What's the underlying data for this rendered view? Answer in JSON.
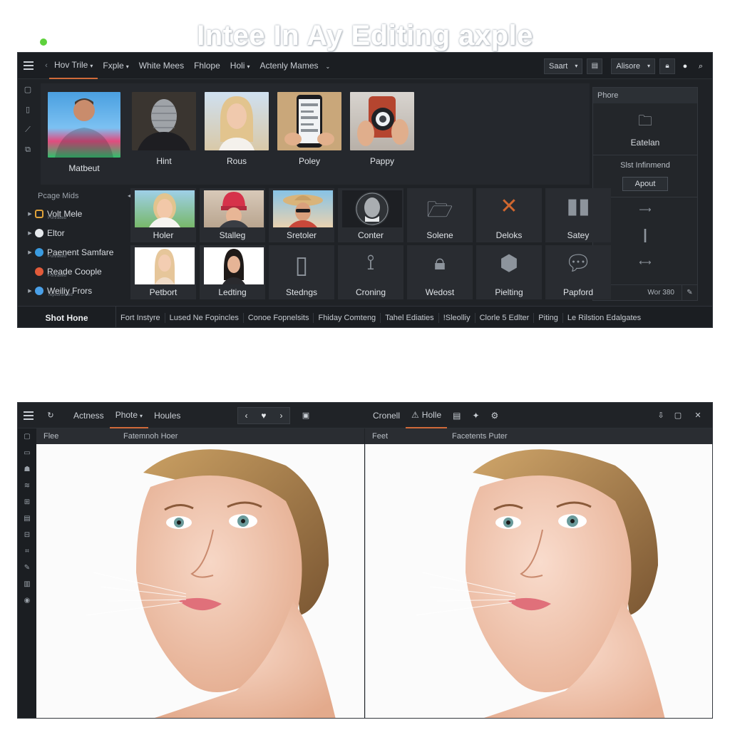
{
  "headline": "Intee In Ay Editing axple",
  "colors": {
    "accent": "#d06a3a",
    "status_dot": "#5ed13c",
    "bg_dark": "#1f2226"
  },
  "top_window": {
    "menu": [
      {
        "label": "Hov Trile",
        "active": true,
        "chevron": true
      },
      {
        "label": "Fxple",
        "chevron": true
      },
      {
        "label": "White Mees"
      },
      {
        "label": "Fhlope"
      },
      {
        "label": "Holi",
        "chevron": true
      },
      {
        "label": "Actenly Mames",
        "chevron": true
      }
    ],
    "right_dropdown_1": "Saart",
    "right_dropdown_2": "Alisore",
    "gallery": [
      {
        "label": "Matbeut",
        "icon": "man-back-photo"
      },
      {
        "label": "Hint",
        "icon": "microphone-photo"
      },
      {
        "label": "Rous",
        "icon": "woman-portrait-photo"
      },
      {
        "label": "Poley",
        "icon": "phone-photo"
      },
      {
        "label": "Pappy",
        "icon": "camera-phone-photo"
      }
    ],
    "side_panel": {
      "title": "Phore",
      "item_1": "Eatelan",
      "item_2": "Slst Infinmend",
      "button": "Apout",
      "footer_value": "Wor 380"
    },
    "left_list": {
      "title": "Pcage Mids",
      "items": [
        {
          "label": "Volt Mele",
          "sub": "Portraited"
        },
        {
          "label": "Eltor"
        },
        {
          "label": "Paenent Samfare",
          "sub": "Portraited"
        },
        {
          "label": "Reade Coople",
          "sub": "Portraited"
        },
        {
          "label": "Weiliy Frors",
          "sub": "Tepsoroneed"
        }
      ]
    },
    "tiles_row1": [
      "Holer",
      "Stalleg",
      "Sretoler",
      "Conter",
      "Solene",
      "Deloks",
      "Satey"
    ],
    "tiles_row2": [
      "Petbort",
      "Ledting",
      "Stedngs",
      "Croning",
      "Wedost",
      "Pielting",
      "Papford"
    ],
    "bottom_bar": {
      "home": "Shot Hone",
      "items": [
        "Fort Instyre",
        "Lused Ne Fopincles",
        "Conoe Fopnelsits",
        "Fhiday Comteng",
        "Tahel Ediaties",
        "!Sleolliy",
        "Clorle 5 Edlter",
        "Piting",
        "Le Rilstion Edalgates"
      ]
    }
  },
  "bottom_window": {
    "menu_left": [
      {
        "label": "Actness"
      },
      {
        "label": "Phote",
        "active": true,
        "chevron": true
      },
      {
        "label": "Houles"
      }
    ],
    "menu_right": [
      {
        "label": "Cronell"
      },
      {
        "label": "Holle",
        "active": true
      }
    ],
    "left_pane": {
      "header_left": "Flee",
      "header_right": "Fatemnoh Hoer"
    },
    "right_pane": {
      "header_left": "Feet",
      "header_right": "Facetents Puter"
    }
  }
}
